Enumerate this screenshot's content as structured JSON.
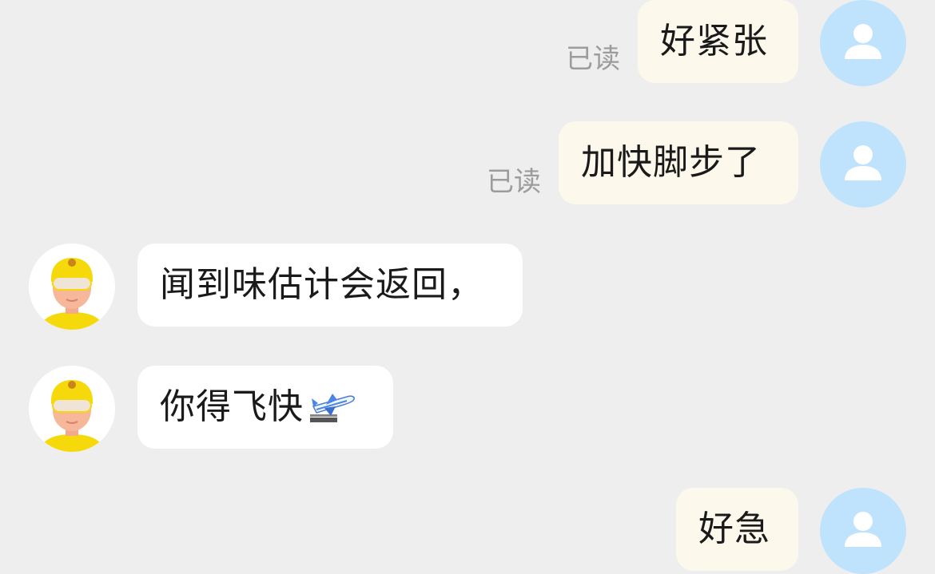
{
  "colors": {
    "background": "#eeeeee",
    "outgoing_bubble": "#fcf9ec",
    "incoming_bubble": "#ffffff",
    "user_avatar_bg": "#bfe3fd",
    "courier_helmet": "#f5d90a",
    "read_receipt_text": "#9c9c9c"
  },
  "messages": [
    {
      "direction": "outgoing",
      "text": "好紧张",
      "status": "已读",
      "avatar_icon": "user-icon"
    },
    {
      "direction": "outgoing",
      "text": "加快脚步了",
      "status": "已读",
      "avatar_icon": "user-icon"
    },
    {
      "direction": "incoming",
      "text": "闻到味估计会返回，",
      "avatar_icon": "courier-avatar-icon"
    },
    {
      "direction": "incoming",
      "text": "你得飞快",
      "emoji": "airplane-icon",
      "avatar_icon": "courier-avatar-icon"
    },
    {
      "direction": "outgoing",
      "text": "好急",
      "avatar_icon": "user-icon"
    }
  ]
}
